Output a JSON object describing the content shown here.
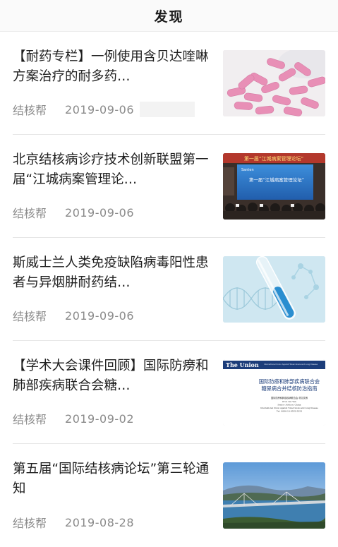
{
  "header": {
    "title": "发现"
  },
  "articles": [
    {
      "title": "【耐药专栏】一例使用含贝达喹啉方案治疗的耐多药…",
      "source": "结核帮",
      "date": "2019-09-06",
      "thumb": "pills-image"
    },
    {
      "title": "北京结核病诊疗技术创新联盟第一届“江城病案管理论…",
      "source": "结核帮",
      "date": "2019-09-06",
      "thumb": "conference-image",
      "thumb_text": {
        "banner": "第一届“江城病案管理论坛”",
        "screen_logo": "Santen",
        "screen_title": "第一届“江城病案管理论坛”"
      }
    },
    {
      "title": "斯威士兰人类免疫缺陷病毒阳性患者与异烟肼耐药结…",
      "source": "结核帮",
      "date": "2019-09-06",
      "thumb": "dna-test-tube-image"
    },
    {
      "title": "【学术大会课件回顾】国际防痨和肺部疾病联合会糖…",
      "source": "结核帮",
      "date": "2019-09-02",
      "thumb": "the-union-slide-image",
      "thumb_text": {
        "logo": "The Union",
        "org": "International Union Against Tuberculosis and Lung Disease",
        "heading1": "国际防痨和肺部疾病联合会",
        "heading2": "糖尿病合并结核防治指南",
        "line1": "国际防痨和肺部疾病联合会  林文奕博",
        "line2": "Prof. Lin Yan",
        "line3": "Senior Advisor, China",
        "line4": "International Union Against Tuberculosis and Lung Disease",
        "line5": "Tel: 0086-10-8532-5353"
      }
    },
    {
      "title": "第五届“国际结核病论坛”第三轮通知",
      "source": "结核帮",
      "date": "2019-08-28",
      "thumb": "bridge-landscape-image"
    }
  ],
  "colors": {
    "text_primary": "#1f1f1f",
    "text_meta": "#8a8a8a",
    "divider": "#e6e6e6",
    "union_blue": "#1c3d7a"
  }
}
